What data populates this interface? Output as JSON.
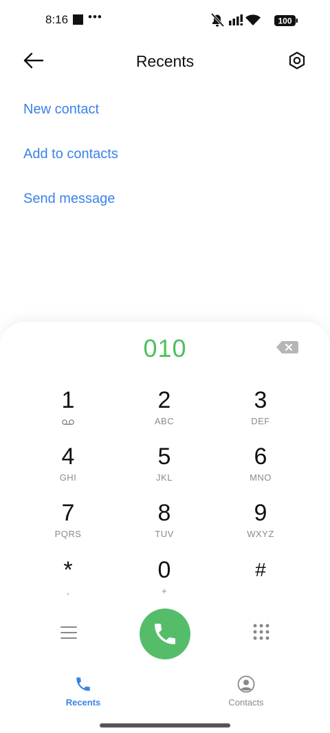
{
  "status_bar": {
    "time": "8:16",
    "dots": "•••",
    "battery": "100"
  },
  "header": {
    "title": "Recents"
  },
  "actions": [
    "New contact",
    "Add to contacts",
    "Send message"
  ],
  "dialer": {
    "number": "010",
    "keys": [
      {
        "digit": "1",
        "sub": ""
      },
      {
        "digit": "2",
        "sub": "ABC"
      },
      {
        "digit": "3",
        "sub": "DEF"
      },
      {
        "digit": "4",
        "sub": "GHI"
      },
      {
        "digit": "5",
        "sub": "JKL"
      },
      {
        "digit": "6",
        "sub": "MNO"
      },
      {
        "digit": "7",
        "sub": "PQRS"
      },
      {
        "digit": "8",
        "sub": "TUV"
      },
      {
        "digit": "9",
        "sub": "WXYZ"
      },
      {
        "digit": "*",
        "sub": ","
      },
      {
        "digit": "0",
        "sub": "+"
      },
      {
        "digit": "#",
        "sub": ""
      }
    ]
  },
  "bottom_nav": {
    "tabs": [
      {
        "label": "Recents",
        "icon": "phone-icon",
        "active": true
      },
      {
        "label": "Contacts",
        "icon": "person-icon",
        "active": false
      }
    ]
  },
  "colors": {
    "accent": "#3b82e8",
    "call_green": "#55bd6a",
    "number_green": "#4cc05c"
  }
}
